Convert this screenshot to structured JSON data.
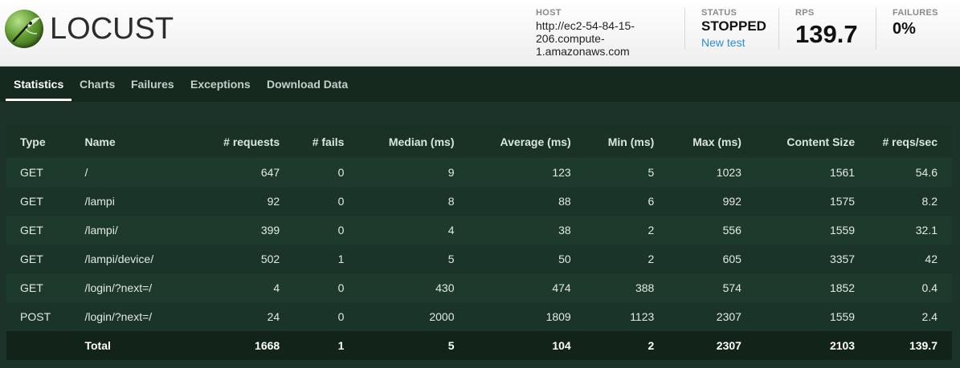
{
  "app": {
    "name": "LOCUST"
  },
  "header": {
    "host": {
      "label": "HOST",
      "lines": [
        "http://ec2-54-84-15-",
        "206.compute-",
        "1.amazonaws.com"
      ]
    },
    "status": {
      "label": "STATUS",
      "value": "STOPPED",
      "link": "New test"
    },
    "rps": {
      "label": "RPS",
      "value": "139.7"
    },
    "failures": {
      "label": "FAILURES",
      "value": "0%"
    }
  },
  "tabs": [
    {
      "label": "Statistics",
      "active": true
    },
    {
      "label": "Charts",
      "active": false
    },
    {
      "label": "Failures",
      "active": false
    },
    {
      "label": "Exceptions",
      "active": false
    },
    {
      "label": "Download Data",
      "active": false
    }
  ],
  "table": {
    "columns": [
      "Type",
      "Name",
      "# requests",
      "# fails",
      "Median (ms)",
      "Average (ms)",
      "Min (ms)",
      "Max (ms)",
      "Content Size",
      "# reqs/sec"
    ],
    "rows": [
      [
        "GET",
        "/",
        "647",
        "0",
        "9",
        "123",
        "5",
        "1023",
        "1561",
        "54.6"
      ],
      [
        "GET",
        "/lampi",
        "92",
        "0",
        "8",
        "88",
        "6",
        "992",
        "1575",
        "8.2"
      ],
      [
        "GET",
        "/lampi/",
        "399",
        "0",
        "4",
        "38",
        "2",
        "556",
        "1559",
        "32.1"
      ],
      [
        "GET",
        "/lampi/device/",
        "502",
        "1",
        "5",
        "50",
        "2",
        "605",
        "3357",
        "42"
      ],
      [
        "GET",
        "/login/?next=/",
        "4",
        "0",
        "430",
        "474",
        "388",
        "574",
        "1852",
        "0.4"
      ],
      [
        "POST",
        "/login/?next=/",
        "24",
        "0",
        "2000",
        "1809",
        "1123",
        "2307",
        "1559",
        "2.4"
      ]
    ],
    "total": [
      "",
      "Total",
      "1668",
      "1",
      "5",
      "104",
      "2",
      "2307",
      "2103",
      "139.7"
    ]
  },
  "colors": {
    "accent_link": "#2e8bd6",
    "background": "#1b3328",
    "tab_bar": "#16291f"
  }
}
